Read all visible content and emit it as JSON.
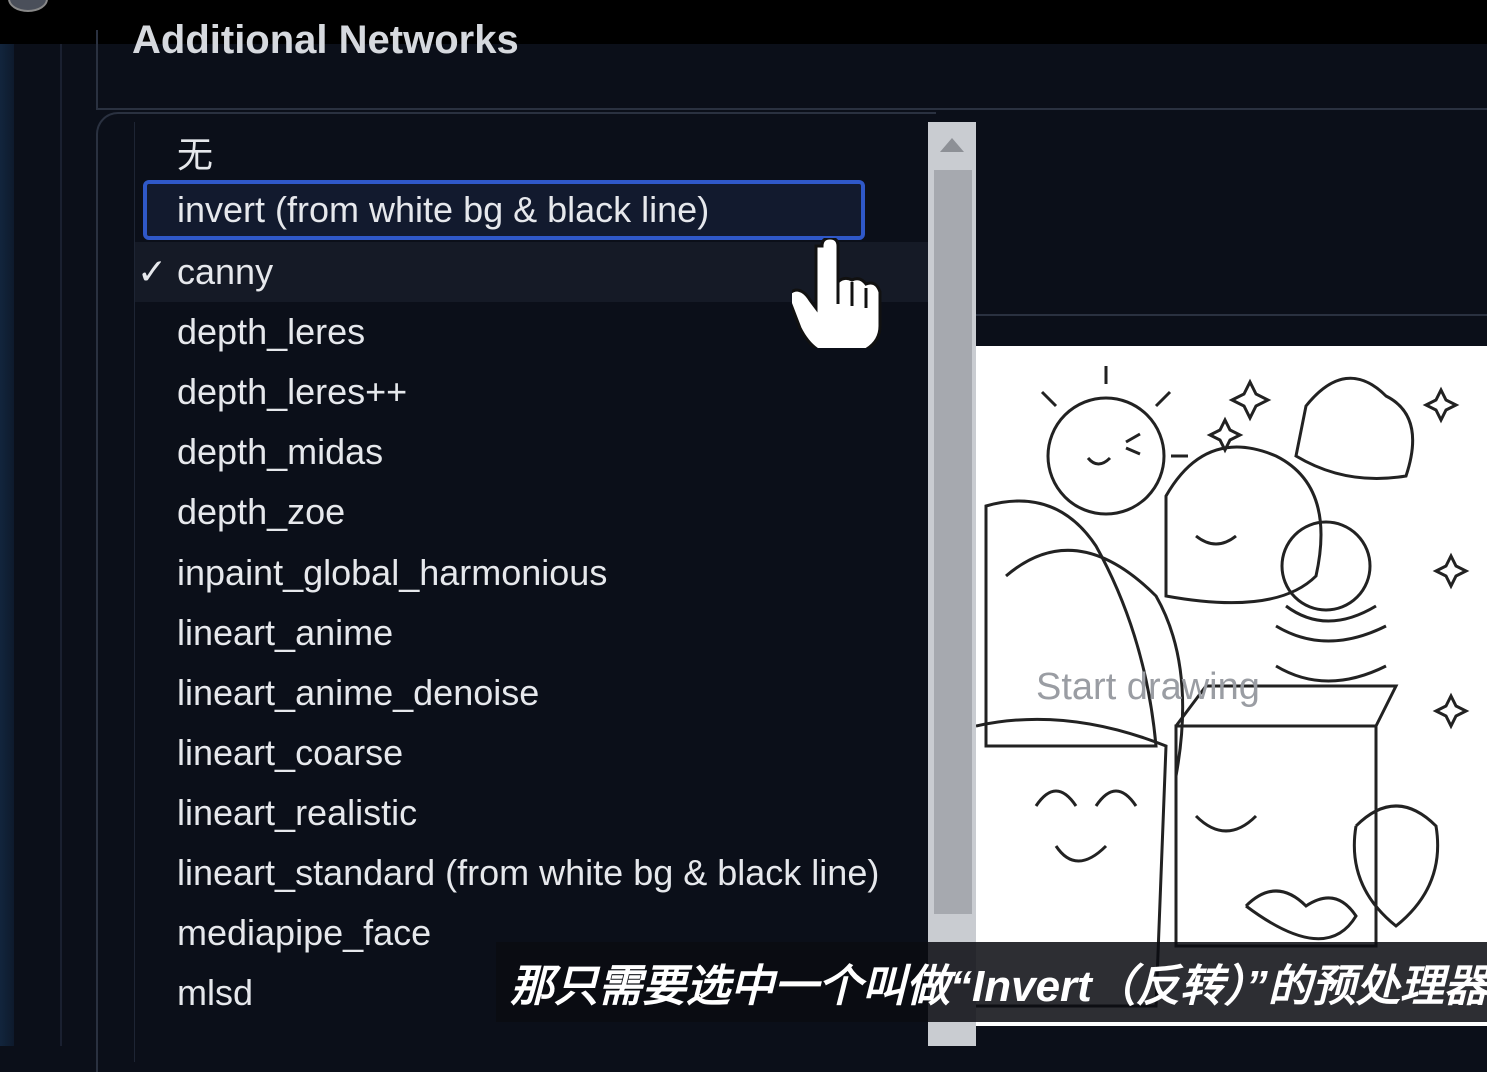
{
  "header": {
    "section_title": "Additional Networks"
  },
  "preprocessor_dropdown": {
    "options": [
      {
        "label": "无"
      },
      {
        "label": "invert (from white bg & black line)"
      },
      {
        "label": "canny"
      },
      {
        "label": "depth_leres"
      },
      {
        "label": "depth_leres++"
      },
      {
        "label": "depth_midas"
      },
      {
        "label": "depth_zoe"
      },
      {
        "label": "inpaint_global_harmonious"
      },
      {
        "label": "lineart_anime"
      },
      {
        "label": "lineart_anime_denoise"
      },
      {
        "label": "lineart_coarse"
      },
      {
        "label": "lineart_realistic"
      },
      {
        "label": "lineart_standard (from white bg & black line)"
      },
      {
        "label": "mediapipe_face"
      },
      {
        "label": "mlsd"
      }
    ],
    "selected_value": "canny",
    "focused_value": "invert (from white bg & black line)",
    "check_glyph": "✓"
  },
  "canvas": {
    "placeholder": "Start drawing"
  },
  "video_subtitle": {
    "text": "那只需要选中一个叫做“Invert（反转）”的预处理器"
  },
  "colors": {
    "background": "#0b0f19",
    "focus_border": "#2f58c8",
    "text": "#e6e8ec"
  }
}
